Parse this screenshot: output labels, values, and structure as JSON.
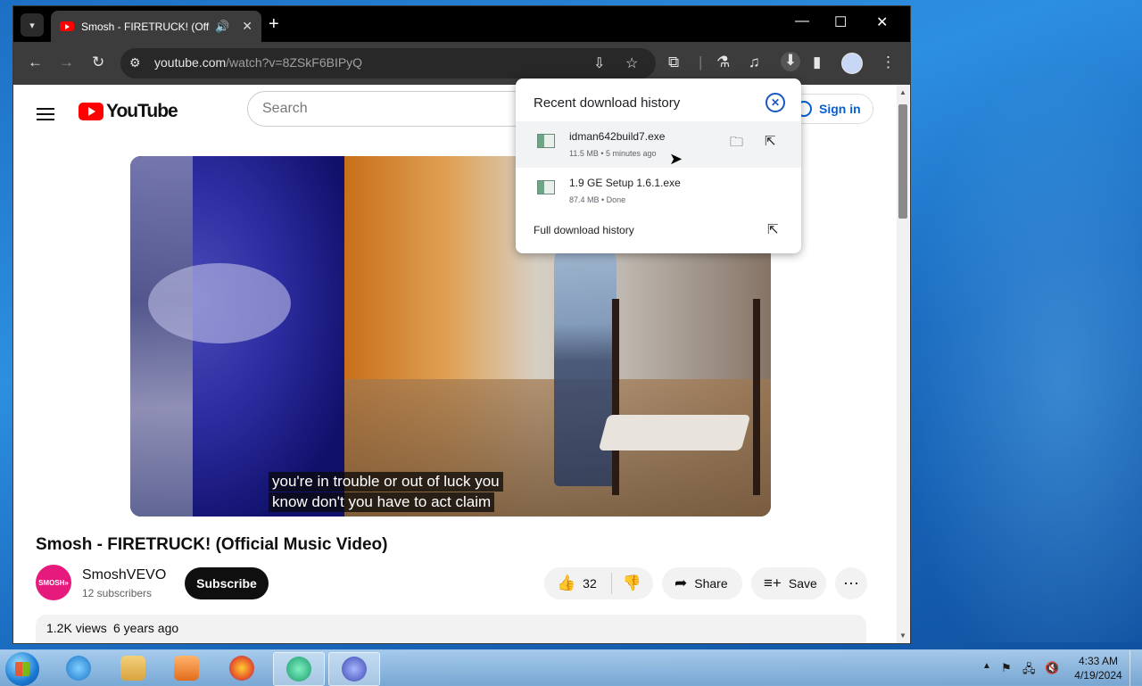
{
  "browser": {
    "tab": {
      "title": "Smosh - FIRETRUCK! (Official Music Video) - YouTube",
      "close": "✕"
    },
    "new_tab": "+",
    "window_controls": {
      "minimize": "—",
      "maximize": "☐",
      "close": "✕"
    },
    "address": {
      "host": "youtube.com",
      "path": "/watch?v=8ZSkF6BIPyQ"
    }
  },
  "youtube": {
    "logo_text": "YouTube",
    "search_placeholder": "Search",
    "sign_in": "Sign in",
    "video": {
      "caption_line1": "you're in trouble or out of luck you",
      "caption_line2": "know don't you have to act claim",
      "title": "Smosh - FIRETRUCK! (Official Music Video)"
    },
    "channel": {
      "avatar_text": "SMOSH»",
      "name": "SmoshVEVO",
      "subscribers": "12 subscribers"
    },
    "subscribe": "Subscribe",
    "actions": {
      "likes": "32",
      "share": "Share",
      "save": "Save"
    },
    "description": {
      "views": "1.2K views",
      "age": "6 years ago"
    }
  },
  "downloads_panel": {
    "header": "Recent download history",
    "items": [
      {
        "name": "idman642build7.exe",
        "meta": "11.5 MB • 5 minutes ago"
      },
      {
        "name": "1.9 GE Setup 1.6.1.exe",
        "meta": "87.4 MB • Done"
      }
    ],
    "full_history": "Full download history"
  },
  "taskbar": {
    "clock_time": "4:33 AM",
    "clock_date": "4/19/2024"
  },
  "colors": {
    "youtube_red": "#ff0000",
    "link_blue": "#065fd4",
    "chrome_dark": "#3c3c3c"
  }
}
